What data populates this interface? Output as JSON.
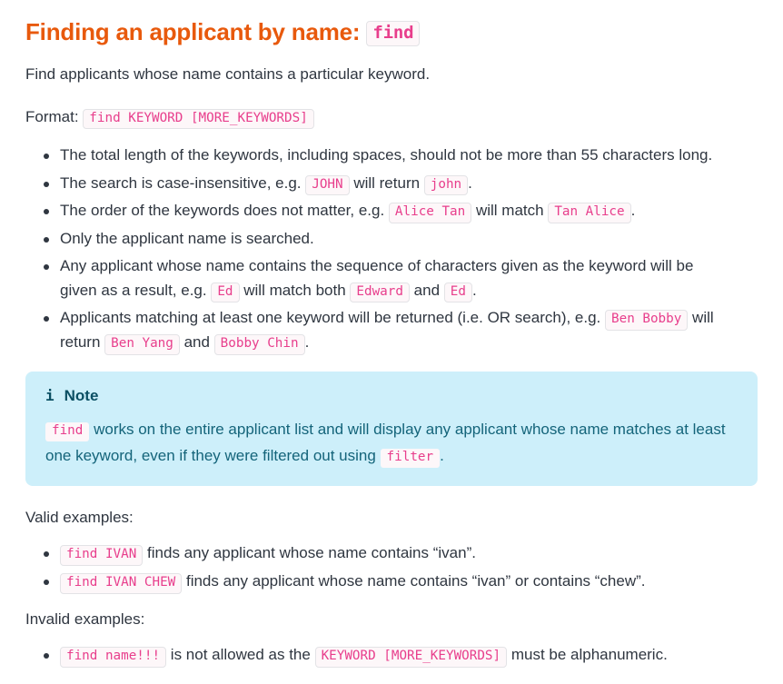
{
  "heading": {
    "text": "Finding an applicant by name:",
    "command": "find",
    "color": "#e8590c"
  },
  "intro": "Find applicants whose name contains a particular keyword.",
  "format": {
    "label": "Format:",
    "code": "find KEYWORD [MORE_KEYWORDS]"
  },
  "bullets": [
    {
      "parts": [
        {
          "type": "text",
          "value": "The total length of the keywords, including spaces, should not be more than 55 characters long."
        }
      ]
    },
    {
      "parts": [
        {
          "type": "text",
          "value": "The search is case-insensitive, e.g. "
        },
        {
          "type": "code",
          "value": "JOHN"
        },
        {
          "type": "text",
          "value": " will return "
        },
        {
          "type": "code",
          "value": "john"
        },
        {
          "type": "text",
          "value": "."
        }
      ]
    },
    {
      "parts": [
        {
          "type": "text",
          "value": "The order of the keywords does not matter, e.g. "
        },
        {
          "type": "code",
          "value": "Alice Tan"
        },
        {
          "type": "text",
          "value": " will match "
        },
        {
          "type": "code",
          "value": "Tan Alice"
        },
        {
          "type": "text",
          "value": "."
        }
      ]
    },
    {
      "parts": [
        {
          "type": "text",
          "value": "Only the applicant name is searched."
        }
      ]
    },
    {
      "parts": [
        {
          "type": "text",
          "value": "Any applicant whose name contains the sequence of characters given as the keyword will be given as a result, e.g. "
        },
        {
          "type": "code",
          "value": "Ed"
        },
        {
          "type": "text",
          "value": " will match both "
        },
        {
          "type": "code",
          "value": "Edward"
        },
        {
          "type": "text",
          "value": " and "
        },
        {
          "type": "code",
          "value": "Ed"
        },
        {
          "type": "text",
          "value": "."
        }
      ]
    },
    {
      "parts": [
        {
          "type": "text",
          "value": "Applicants matching at least one keyword will be returned (i.e. OR search), e.g. "
        },
        {
          "type": "code",
          "value": "Ben Bobby"
        },
        {
          "type": "text",
          "value": " will return "
        },
        {
          "type": "code",
          "value": "Ben Yang"
        },
        {
          "type": "text",
          "value": " and "
        },
        {
          "type": "code",
          "value": "Bobby Chin"
        },
        {
          "type": "text",
          "value": "."
        }
      ]
    }
  ],
  "note": {
    "icon": "info-icon",
    "icon_glyph": "i",
    "title": "Note",
    "background_color": "#cdeffa",
    "text_color": "#14647a",
    "parts": [
      {
        "type": "code",
        "value": "find"
      },
      {
        "type": "text",
        "value": " works on the entire applicant list and will display any applicant whose name matches at least one keyword, even if they were filtered out using "
      },
      {
        "type": "code",
        "value": "filter"
      },
      {
        "type": "text",
        "value": "."
      }
    ]
  },
  "valid": {
    "label": "Valid examples:",
    "items": [
      {
        "parts": [
          {
            "type": "code",
            "value": "find IVAN"
          },
          {
            "type": "text",
            "value": " finds any applicant whose name contains “ivan”."
          }
        ]
      },
      {
        "parts": [
          {
            "type": "code",
            "value": "find IVAN CHEW"
          },
          {
            "type": "text",
            "value": " finds any applicant whose name contains “ivan” or contains “chew”."
          }
        ]
      }
    ]
  },
  "invalid": {
    "label": "Invalid examples:",
    "items": [
      {
        "parts": [
          {
            "type": "code",
            "value": "find name!!!"
          },
          {
            "type": "text",
            "value": " is not allowed as the "
          },
          {
            "type": "code",
            "value": "KEYWORD [MORE_KEYWORDS]"
          },
          {
            "type": "text",
            "value": " must be alphanumeric."
          }
        ]
      }
    ]
  }
}
